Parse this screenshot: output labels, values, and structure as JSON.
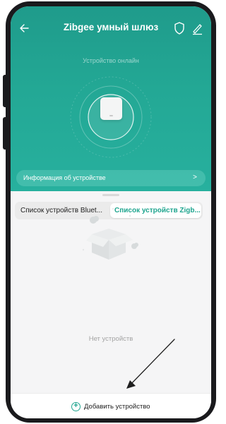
{
  "header": {
    "title": "Zibgee умный шлюз",
    "status": "Устройство онлайн",
    "info_bar_label": "Информация об устройстве",
    "info_chevron": ">"
  },
  "tabs": [
    {
      "label": "Список устройств Bluet...",
      "selected": false
    },
    {
      "label": "Список устройств Zigb...",
      "selected": true
    }
  ],
  "empty_state": {
    "label": "Нет устройств"
  },
  "add_button": {
    "label": "Добавить устройство",
    "icon_glyph": "+"
  },
  "icons": {
    "back": "back-arrow-icon",
    "shield": "shield-icon",
    "edit": "edit-pencil-icon",
    "device": "gateway-device-icon",
    "empty": "empty-box-icon",
    "add": "plus-circle-icon"
  },
  "colors": {
    "accent": "#1fa58f",
    "header_top": "#1f9b8b",
    "header_bottom": "#27b09e"
  }
}
